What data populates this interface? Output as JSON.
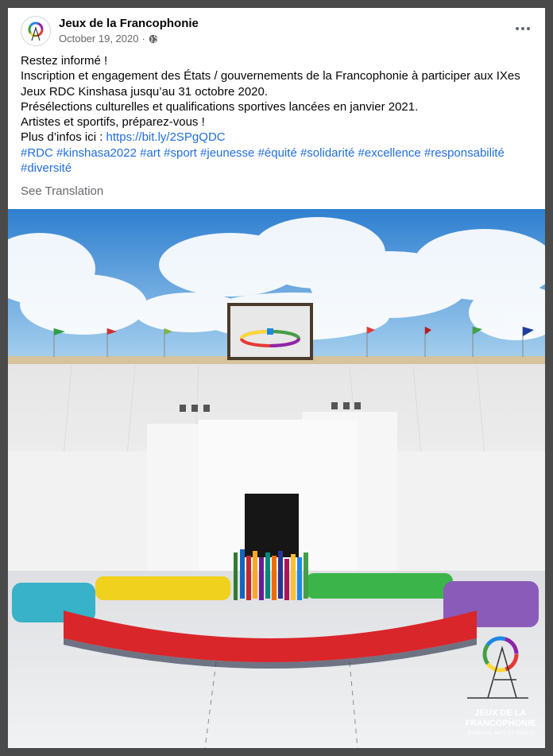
{
  "post": {
    "page_name": "Jeux de la Francophonie",
    "date": "October 19, 2020",
    "separator": "·",
    "privacy_icon": "globe-icon",
    "more_icon": "more-options-icon",
    "lines": [
      "Restez informé !",
      "Inscription et engagement des États / gouvernements de la Francophonie à participer aux IXes",
      "Jeux RDC Kinshasa jusqu’au 31 octobre 2020.",
      "Présélections culturelles et qualifications sportives lancées en janvier 2021.",
      "Artistes et sportifs, préparez-vous !"
    ],
    "more_info_prefix": "Plus d’infos ici : ",
    "link": "https://bit.ly/2SPgQDC",
    "hashtags_line1": [
      "#RDC",
      "#kinshasa2022",
      "#art",
      "#sport",
      "#jeunesse",
      "#équité",
      "#solidarité",
      "#excellence",
      "#responsabilité"
    ],
    "hashtags_line2": [
      "#diversité"
    ],
    "see_translation": "See Translation"
  },
  "image": {
    "logo_line1": "JEUX DE LA",
    "logo_line2": "FRANCOPHONIE",
    "logo_tagline": "JEUNESSE, ARTS ET SPORTS",
    "logo_colors": [
      "#e53935",
      "#fdd835",
      "#43a047",
      "#1e88e5",
      "#8e24aa"
    ]
  }
}
